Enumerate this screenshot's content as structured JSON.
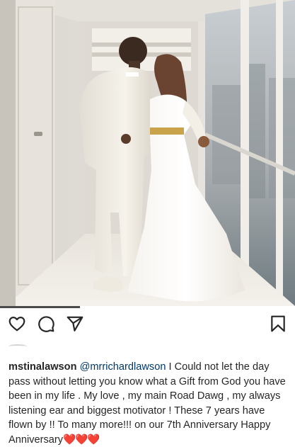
{
  "post": {
    "username": "mstinalawson",
    "mention": "@mrrichardlawson",
    "caption_text": "I Could not let the day pass without letting you know what a Gift from God you have been in my life . My love , my main Road Dawg , my always listening ear and biggest motivator ! These 7 years have flown by !! To many more!!! on our 7th Anniversary Happy Anniversary",
    "caption_emoji": "❤️❤️❤️"
  },
  "actions": {
    "like_icon": "heart-outline-icon",
    "comment_icon": "comment-bubble-icon",
    "share_icon": "paper-plane-icon",
    "save_icon": "bookmark-icon"
  },
  "colors": {
    "text": "#262626",
    "mention": "#00376b",
    "hearts": "#e0213b"
  }
}
